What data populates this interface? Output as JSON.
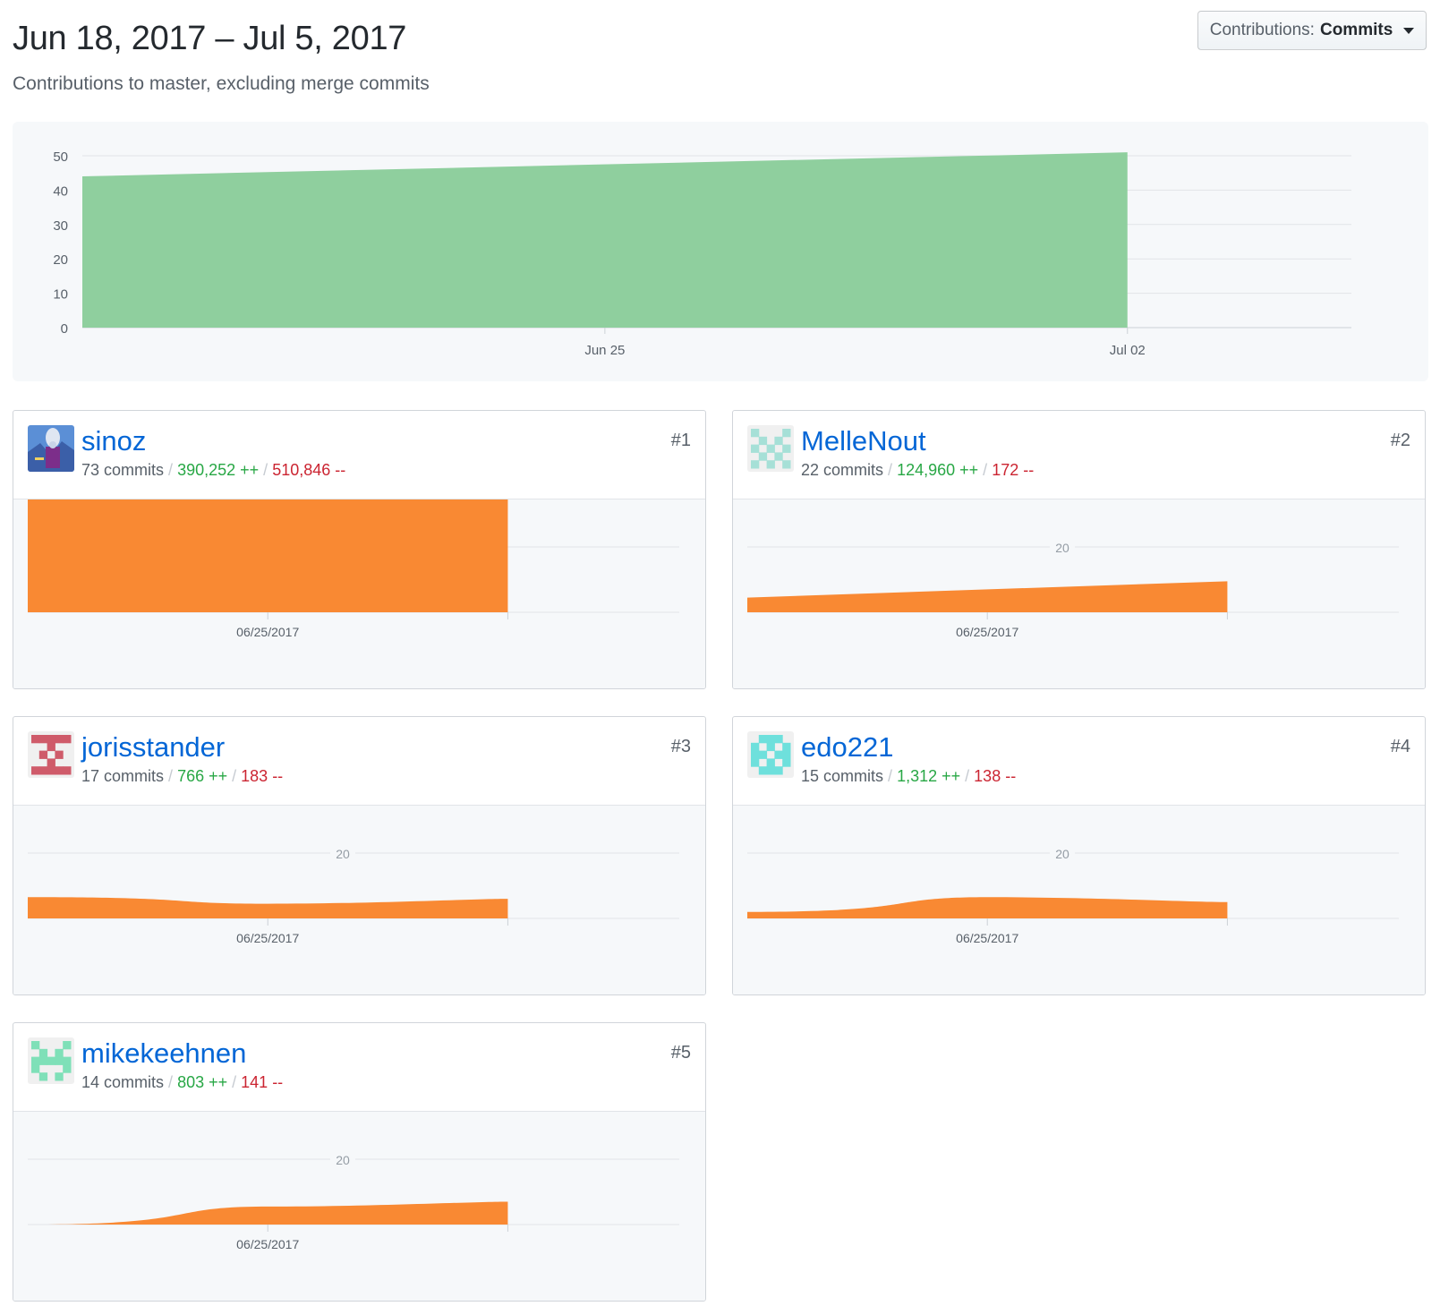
{
  "header": {
    "title": "Jun 18, 2017 – Jul 5, 2017",
    "subtitle": "Contributions to master, excluding merge commits"
  },
  "filter": {
    "label": "Contributions:",
    "value": "Commits"
  },
  "colors": {
    "main_area": "#8fcf9e",
    "card_area": "#f98933",
    "link": "#0366d6",
    "additions": "#28a745",
    "deletions": "#cb2431"
  },
  "chart_data": [
    {
      "type": "area",
      "x_ticks": [
        "Jun 25",
        "Jul 02"
      ],
      "y_ticks": [
        0,
        10,
        20,
        30,
        40,
        50
      ],
      "ylim": [
        0,
        52
      ],
      "x": [
        "Jun 18",
        "Jul 02"
      ],
      "values": [
        44,
        51
      ],
      "grid": true
    },
    {
      "type": "area",
      "x": [
        "Jun 18",
        "Jun 25",
        "Jul 02"
      ],
      "values": [
        48,
        35,
        37
      ],
      "x_tick": "06/25/2017",
      "contributor": "sinoz"
    },
    {
      "type": "area",
      "x": [
        "Jun 18",
        "Jul 02"
      ],
      "values": [
        4.5,
        9.5
      ],
      "x_tick": "06/25/2017",
      "y_tick": 20,
      "contributor": "MelleNout"
    },
    {
      "type": "area",
      "x": [
        "Jun 18",
        "Jun 25",
        "Jul 02"
      ],
      "values": [
        6.5,
        4.5,
        6
      ],
      "x_tick": "06/25/2017",
      "y_tick": 20,
      "contributor": "jorisstander"
    },
    {
      "type": "area",
      "x": [
        "Jun 18",
        "Jun 25",
        "Jul 02"
      ],
      "values": [
        2,
        6.5,
        5
      ],
      "x_tick": "06/25/2017",
      "y_tick": 20,
      "contributor": "edo221"
    },
    {
      "type": "area",
      "x": [
        "Jun 18",
        "Jun 25",
        "Jul 02"
      ],
      "values": [
        0,
        5.5,
        7
      ],
      "x_tick": "06/25/2017",
      "y_tick": 20,
      "contributor": "mikekeehnen"
    }
  ],
  "contributors": [
    {
      "name": "sinoz",
      "commits": "73 commits",
      "additions": "390,252 ++",
      "deletions": "510,846 --",
      "rank": "#1",
      "avatar": "photo-avatar"
    },
    {
      "name": "MelleNout",
      "commits": "22 commits",
      "additions": "124,960 ++",
      "deletions": "172 --",
      "rank": "#2",
      "avatar": "identicon-teal-light"
    },
    {
      "name": "jorisstander",
      "commits": "17 commits",
      "additions": "766 ++",
      "deletions": "183 --",
      "rank": "#3",
      "avatar": "identicon-red"
    },
    {
      "name": "edo221",
      "commits": "15 commits",
      "additions": "1,312 ++",
      "deletions": "138 --",
      "rank": "#4",
      "avatar": "identicon-cyan"
    },
    {
      "name": "mikekeehnen",
      "commits": "14 commits",
      "additions": "803 ++",
      "deletions": "141 --",
      "rank": "#5",
      "avatar": "identicon-mint"
    }
  ]
}
